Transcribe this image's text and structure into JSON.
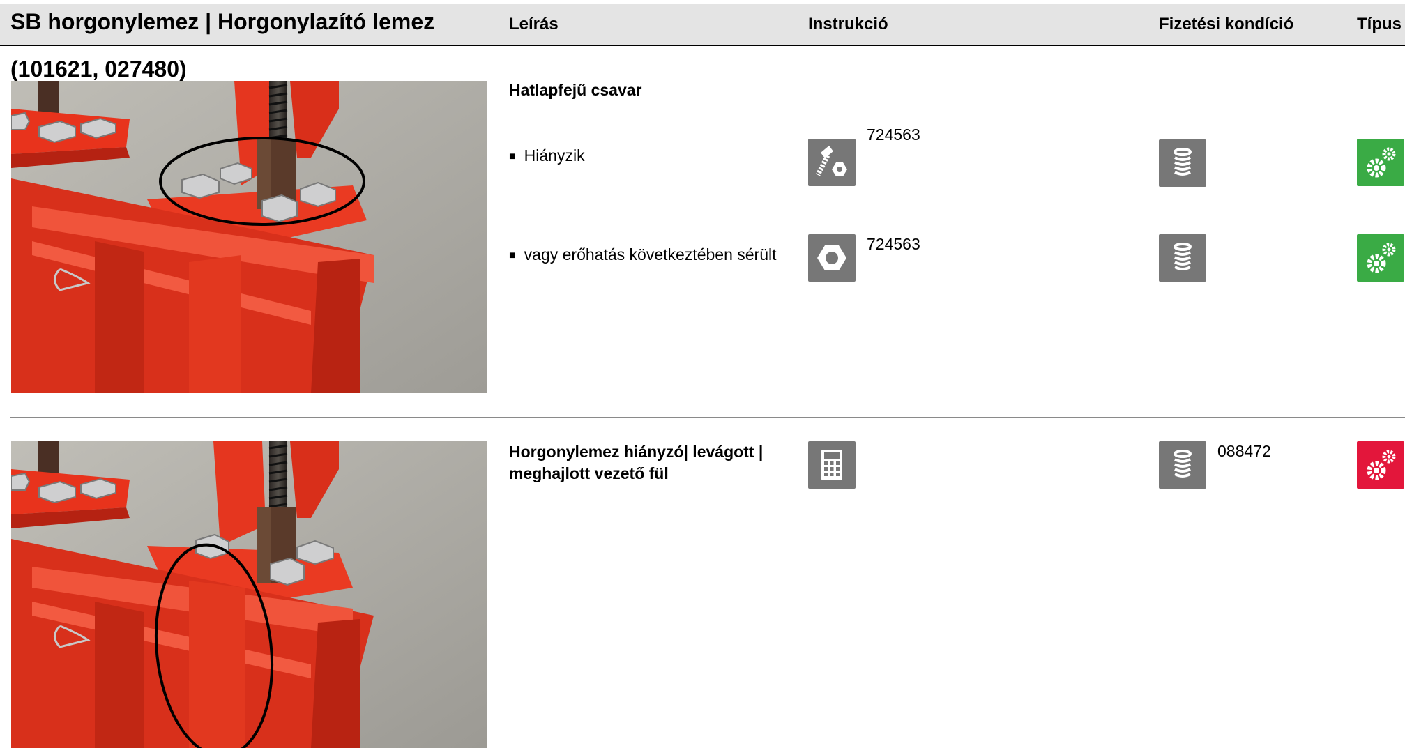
{
  "header": {
    "title": "SB horgonylemez | Horgonylazító lemez",
    "subtitle": "(101621, 027480)",
    "columns": {
      "description": "Leírás",
      "instruction": "Instrukció",
      "payment": "Fizetési kondíció",
      "type": "Típus"
    }
  },
  "section1": {
    "title": "Hatlapfejű csavar",
    "rows": [
      {
        "label": "Hiányzik",
        "instruction_icon": "bolt-and-nut-icon",
        "instruction_code": "724563",
        "payment_icon": "coin-stack-icon",
        "type_icon": "gears-icon",
        "type_color": "#3aab45"
      },
      {
        "label": "vagy erőhatás következtében sérült",
        "instruction_icon": "hex-nut-icon",
        "instruction_code": "724563",
        "payment_icon": "coin-stack-icon",
        "type_icon": "gears-icon",
        "type_color": "#3aab45"
      }
    ]
  },
  "section2": {
    "title_line1": "Horgonylemez hiányzó| levágott |",
    "title_line2": "meghajlott vezető fül",
    "instruction_icon": "calculator-icon",
    "payment_icon": "coin-stack-icon",
    "payment_code": "088472",
    "type_icon": "gears-icon",
    "type_color": "#e3163b"
  },
  "photos": [
    {
      "name": "photo-anchor-plate-bolts",
      "annotation": "ellipse around bolts"
    },
    {
      "name": "photo-anchor-plate-tab",
      "annotation": "ellipse around guide tab"
    }
  ]
}
